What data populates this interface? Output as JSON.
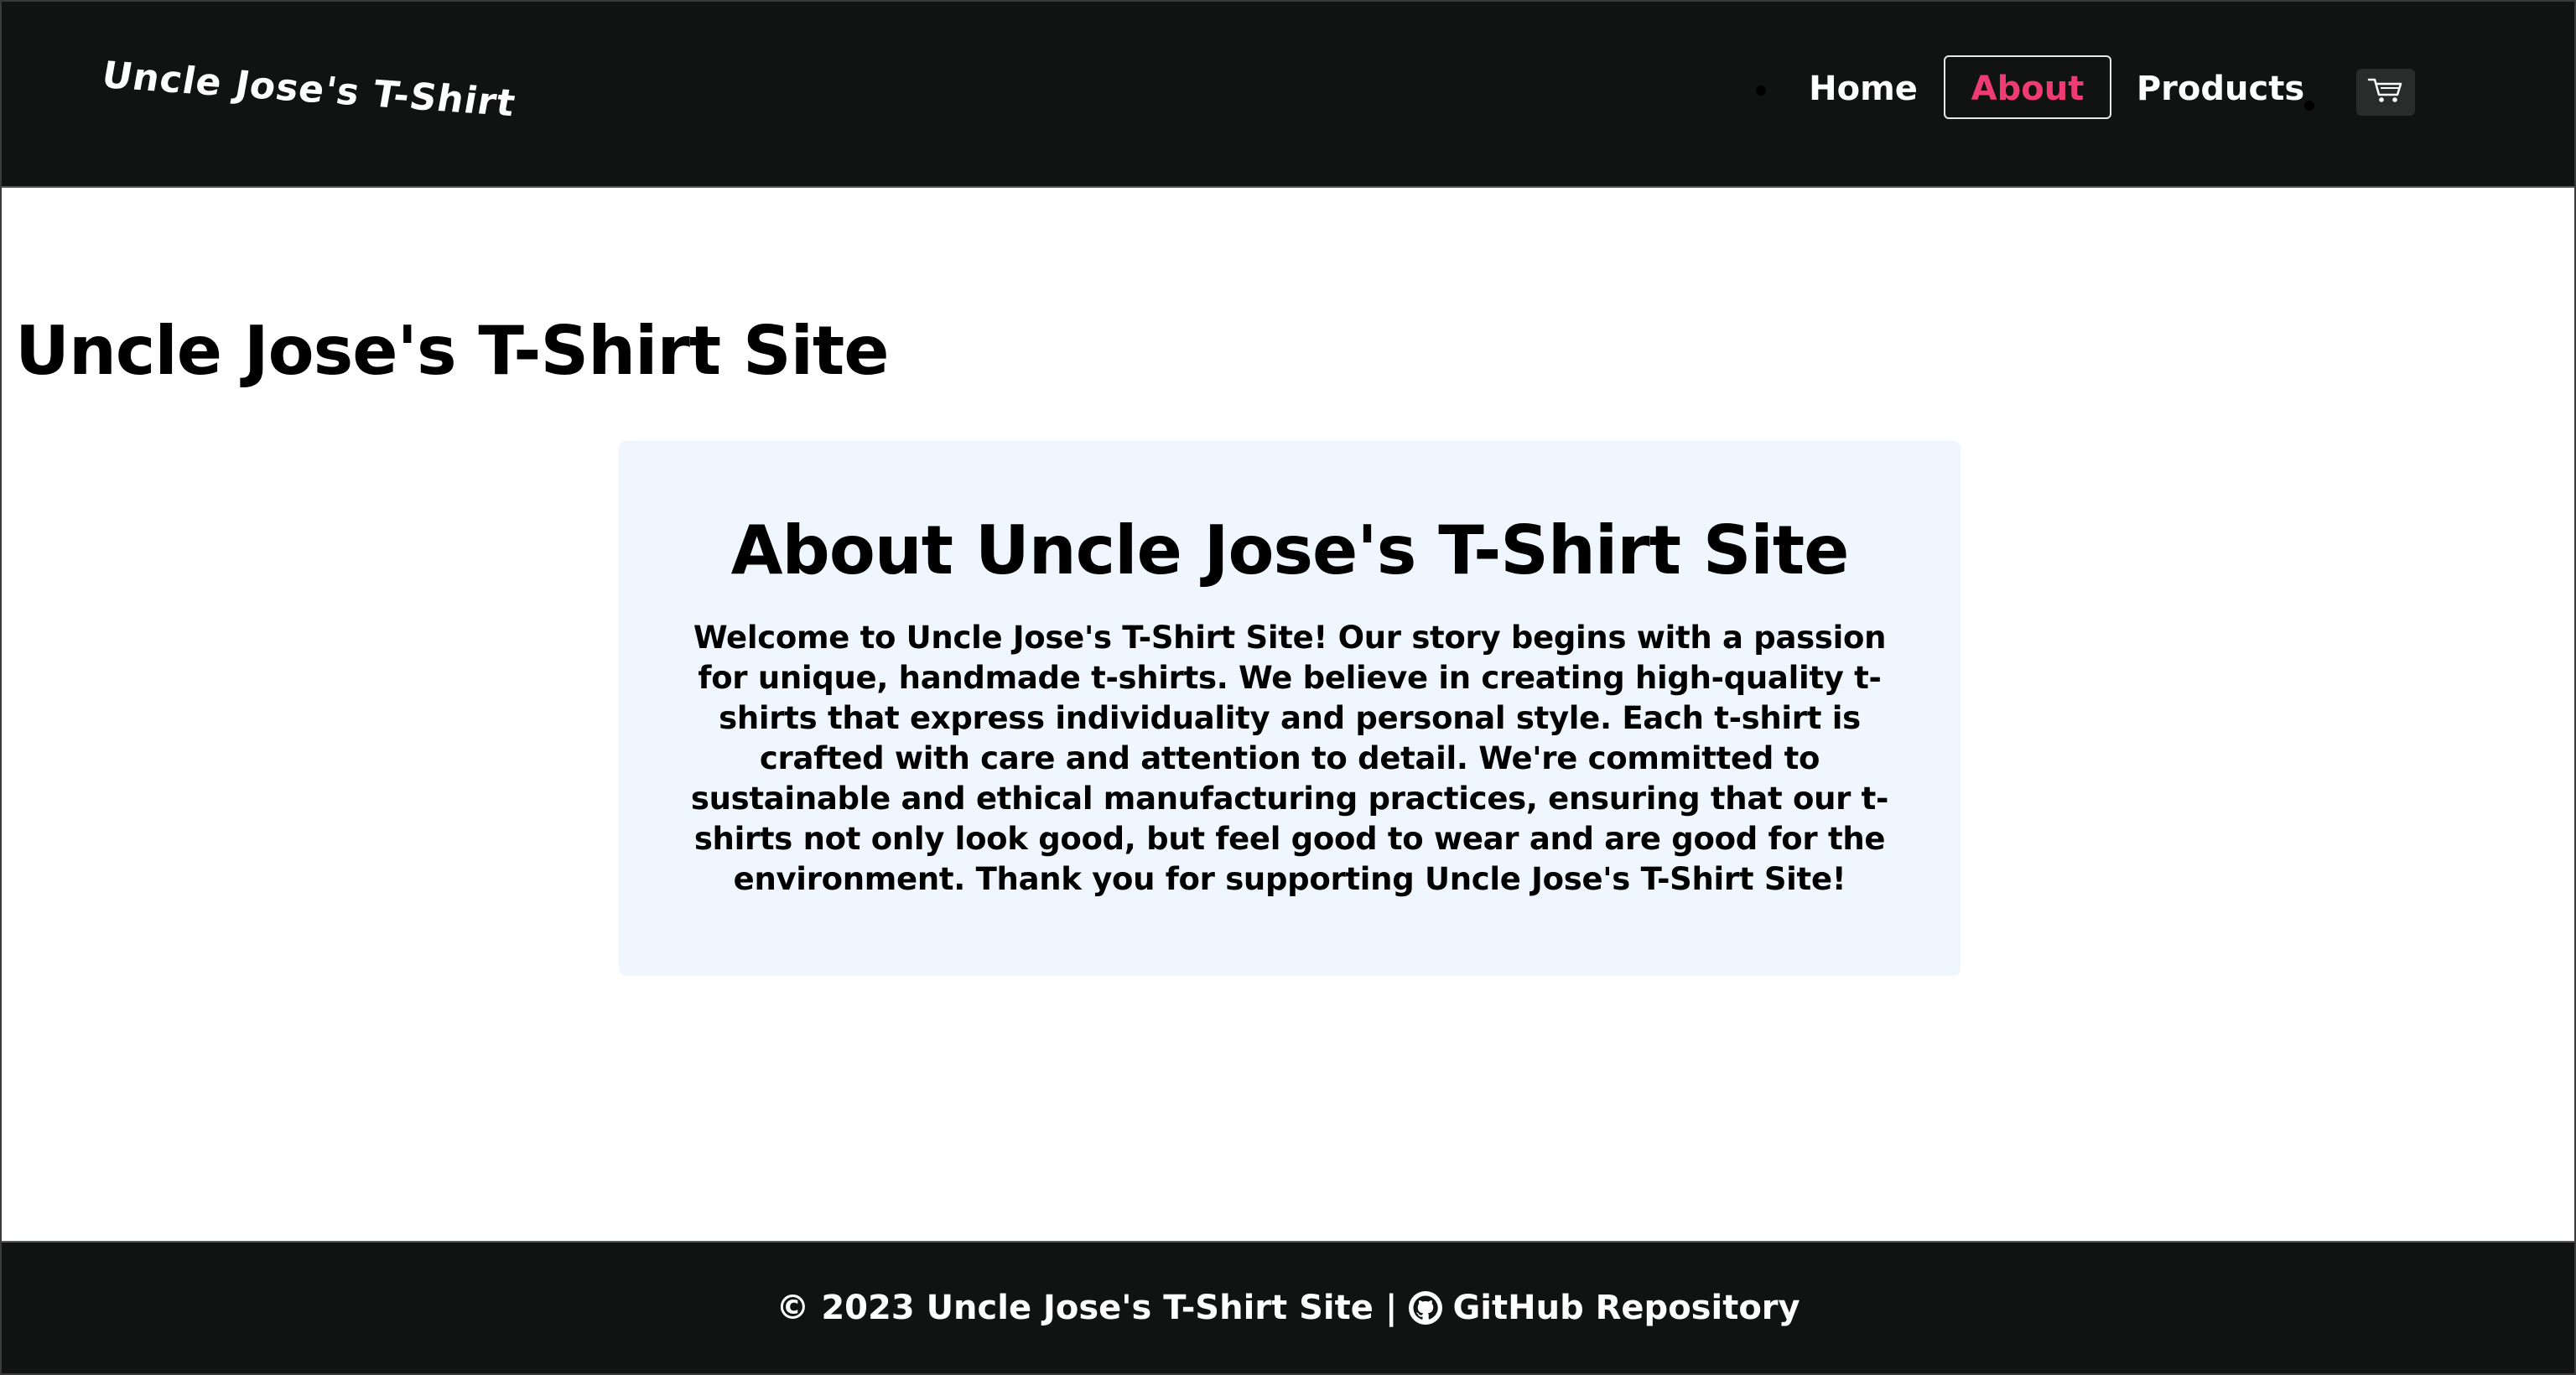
{
  "header": {
    "logo": "Uncle Jose's T-Shirt",
    "nav": [
      {
        "label": "Home"
      },
      {
        "label": "About",
        "active": true
      },
      {
        "label": "Products"
      }
    ],
    "cart_icon": "cart-icon"
  },
  "main": {
    "page_title": "Uncle Jose's T-Shirt Site",
    "about": {
      "heading": "About Uncle Jose's T-Shirt Site",
      "body": "Welcome to Uncle Jose's T-Shirt Site! Our story begins with a passion for unique, handmade t-shirts. We believe in creating high-quality t-shirts that express individuality and personal style. Each t-shirt is crafted with care and attention to detail. We're committed to sustainable and ethical manufacturing practices, ensuring that our t-shirts not only look good, but feel good to wear and are good for the environment. Thank you for supporting Uncle Jose's T-Shirt Site!"
    }
  },
  "footer": {
    "copyright": "© 2023 Uncle Jose's T-Shirt Site",
    "separator": "|",
    "github_icon": "github-icon",
    "github_label": "GitHub Repository"
  },
  "colors": {
    "header_bg": "#111312",
    "accent_active": "#ee3b74",
    "card_bg": "#eff6fd"
  }
}
